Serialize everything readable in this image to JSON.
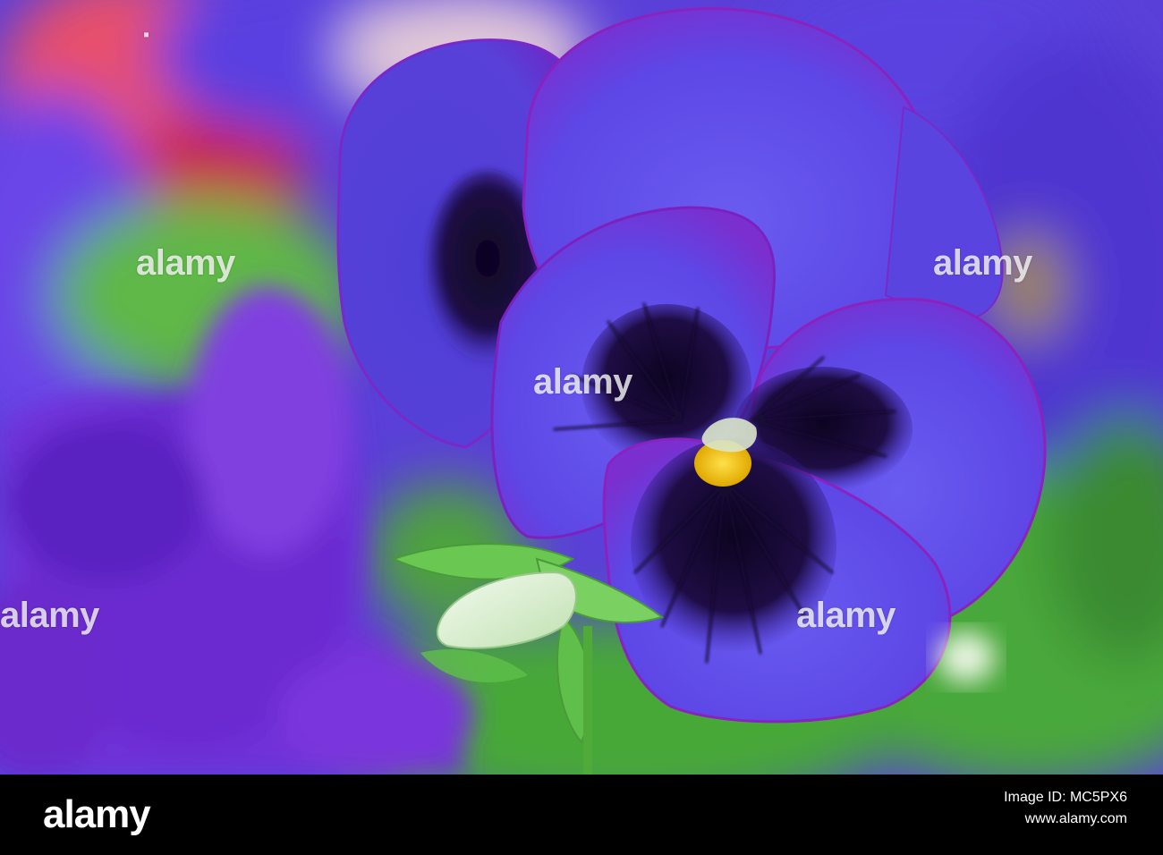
{
  "watermark": {
    "text": "alamy"
  },
  "footer": {
    "brand": "alamy",
    "image_id_label": "Image ID: MC5PX6",
    "site": "www.alamy.com"
  },
  "colors": {
    "petal_main": "#5a3fe0",
    "petal_edge": "#7a22c8",
    "petal_dark_blotch": "#1a0a3a",
    "center_yellow": "#f5c518",
    "leaf_green": "#5fc24a",
    "background_blur_pink": "#e8406a"
  }
}
